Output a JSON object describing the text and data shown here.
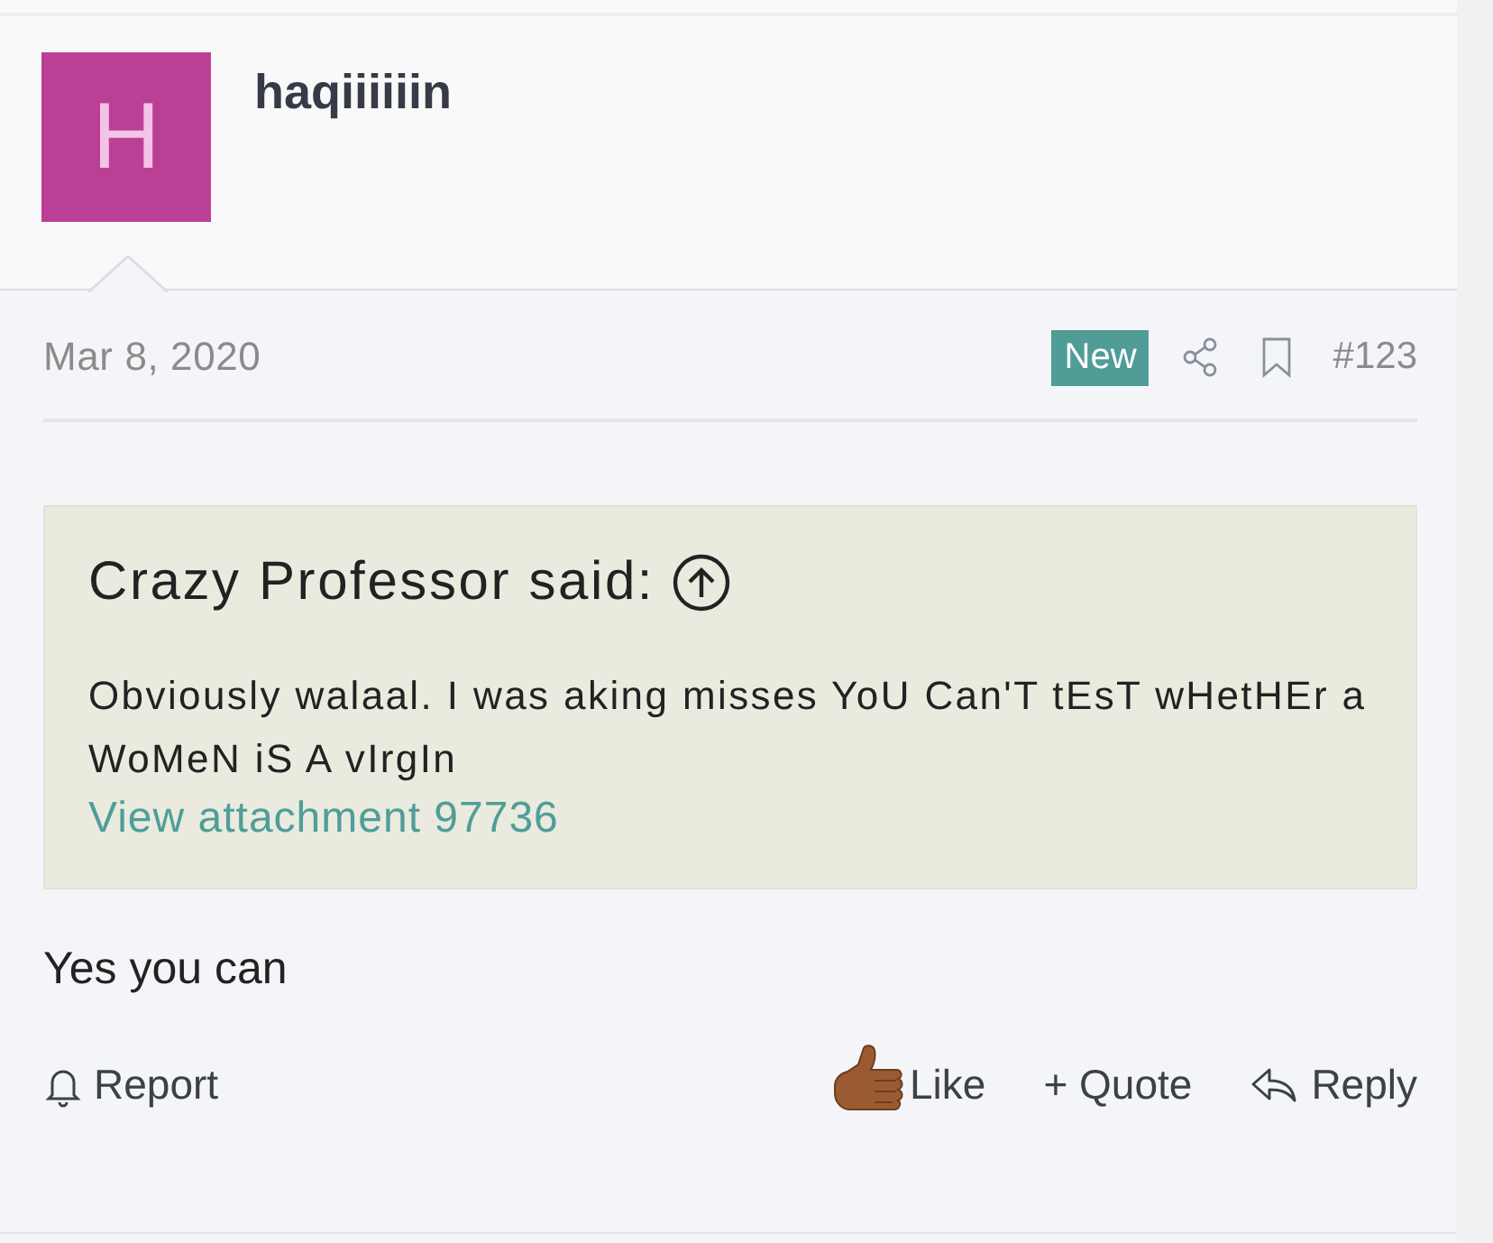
{
  "post": {
    "author": {
      "avatar_letter": "H",
      "name": "haqiiiiiin"
    },
    "date": "Mar 8, 2020",
    "badge": "New",
    "number": "#123",
    "quote": {
      "attribution": "Crazy Professor said:",
      "text": "Obviously walaal. I was aking misses YoU Can'T tEsT wHetHEr a WoMeN iS A vIrgIn",
      "link": "View attachment 97736"
    },
    "message": "Yes you can",
    "actions": {
      "report": "Report",
      "like": "Like",
      "quote": "+ Quote",
      "reply": "Reply"
    }
  }
}
